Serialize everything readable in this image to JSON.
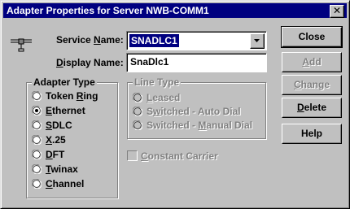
{
  "window": {
    "title": "Adapter Properties for Server NWB-COMM1",
    "close_glyph": "✕"
  },
  "service_name": {
    "label_pre": "Service ",
    "label_key": "N",
    "label_post": "ame:",
    "value": "SNADLC1"
  },
  "display_name": {
    "label_pre": "",
    "label_key": "D",
    "label_post": "isplay Name:",
    "value": "SnaDlc1"
  },
  "adapter_type": {
    "title": "Adapter Type",
    "options": [
      {
        "pre": "Token ",
        "key": "R",
        "post": "ing",
        "selected": false
      },
      {
        "pre": "",
        "key": "E",
        "post": "thernet",
        "selected": true
      },
      {
        "pre": "",
        "key": "S",
        "post": "DLC",
        "selected": false
      },
      {
        "pre": "",
        "key": "X",
        "post": ".25",
        "selected": false
      },
      {
        "pre": "",
        "key": "D",
        "post": "FT",
        "selected": false
      },
      {
        "pre": "",
        "key": "T",
        "post": "winax",
        "selected": false
      },
      {
        "pre": "",
        "key": "C",
        "post": "hannel",
        "selected": false
      }
    ]
  },
  "line_type": {
    "title": "Line Type",
    "options": [
      {
        "pre": "",
        "key": "L",
        "post": "eased"
      },
      {
        "pre": "S",
        "key": "w",
        "post": "itched - Auto Dial"
      },
      {
        "pre": "Switched - ",
        "key": "M",
        "post": "anual Dial"
      }
    ]
  },
  "constant_carrier": {
    "pre": "",
    "key": "C",
    "post": "onstant Carrier",
    "checked": false
  },
  "buttons": {
    "close": "Close",
    "add": {
      "pre": "",
      "key": "A",
      "post": "dd"
    },
    "change": {
      "pre": "",
      "key": "C",
      "post": "hange"
    },
    "delete": {
      "pre": "",
      "key": "D",
      "post": "elete"
    },
    "help": "Help"
  },
  "icons": {
    "network": "network-adapter-icon"
  }
}
